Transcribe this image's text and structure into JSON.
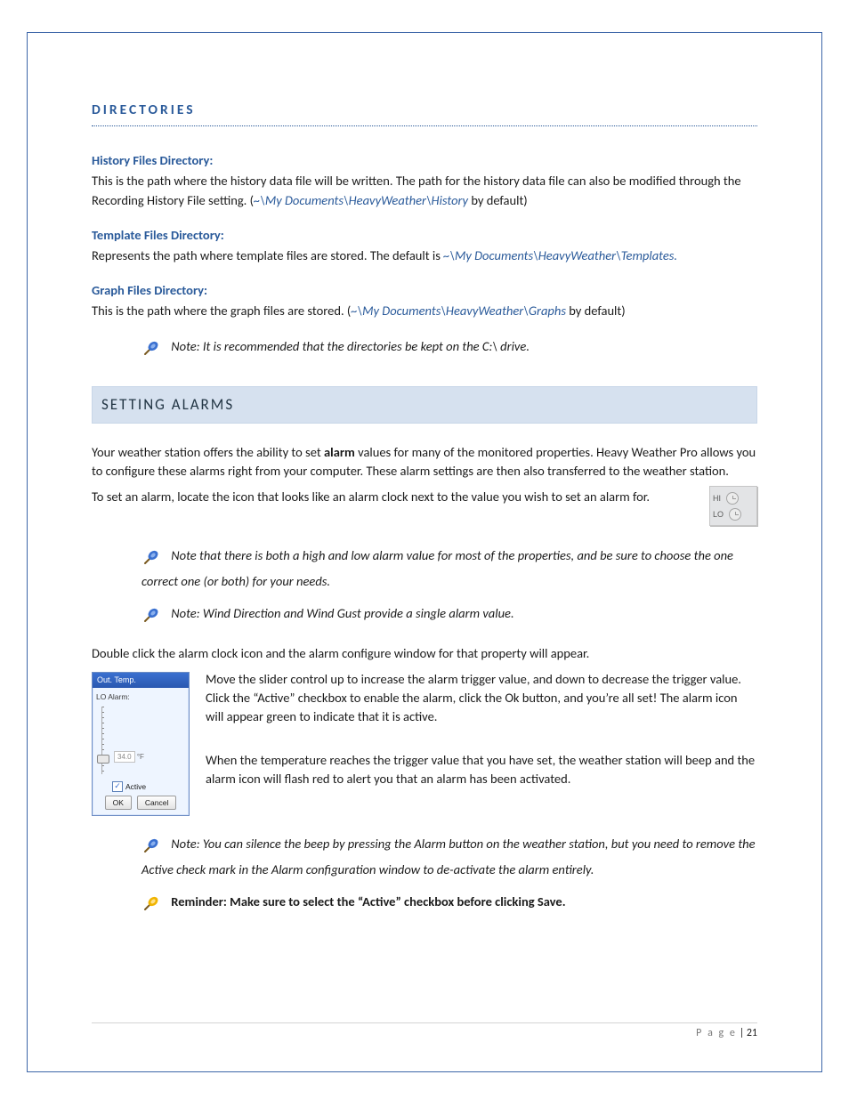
{
  "headings": {
    "directories": "DIRECTORIES",
    "setting_alarms": "SETTING ALARMS"
  },
  "dir": {
    "history": {
      "title": "History Files Directory:",
      "text1": "This is the path where the history data file will be written. The path for the history data file can also be modified through the Recording History File setting. (",
      "path": "~\\My Documents\\HeavyWeather\\History",
      "text2": " by default)"
    },
    "template": {
      "title": "Template Files Directory:",
      "text1": "Represents the path where template files are stored. The default is ",
      "path": "~\\My Documents\\HeavyWeather\\Templates."
    },
    "graph": {
      "title": "Graph Files Directory:",
      "text1": "This is the path where the graph files are stored. (",
      "path": "~\\My Documents\\HeavyWeather\\Graphs",
      "text2": " by default)"
    },
    "note": "Note: It is recommended that the directories be kept on the C:\\ drive."
  },
  "alarms": {
    "intro1a": "Your weather station offers the ability to set ",
    "intro1b": "alarm",
    "intro1c": " values for many of the monitored properties. Heavy Weather Pro allows you to configure these alarms right from your computer. These alarm settings are then also transferred to the weather station.",
    "intro2": " To set an alarm, locate the icon that looks like an alarm clock next to the value you wish to set an alarm for.",
    "hi": "HI",
    "lo": "LO",
    "note1": "Note that there is both a high and low alarm value for most of the properties, and be sure to choose the one correct one (or both) for your needs.",
    "note2": "Note: Wind Direction and Wind Gust provide a single alarm value.",
    "double_click": "Double click the alarm clock icon and the alarm configure window for that property will appear.",
    "slider1": "Move the slider control up to increase the alarm trigger value, and down to decrease the trigger value. Click the “Active” checkbox to enable the alarm, click the Ok button, and you’re all set! The alarm icon will appear green to indicate that it is active.",
    "slider2": "When the temperature reaches the trigger value that you have set, the weather station will beep and the alarm icon will flash red to alert you that an alarm has been activated.",
    "note3": "Note: You can silence the beep by pressing the Alarm button on the weather station, but you need to remove the Active check mark in the Alarm configuration window to de-activate the alarm entirely.",
    "reminder": "Reminder: Make sure to select the “Active” checkbox before clicking Save."
  },
  "dialog": {
    "title": "Out. Temp.",
    "label": "LO Alarm:",
    "value": "34.0",
    "unit": "°F",
    "active": "Active",
    "ok": "OK",
    "cancel": "Cancel"
  },
  "footer": {
    "label": "P a g e",
    "sep": " | ",
    "num": "21"
  }
}
